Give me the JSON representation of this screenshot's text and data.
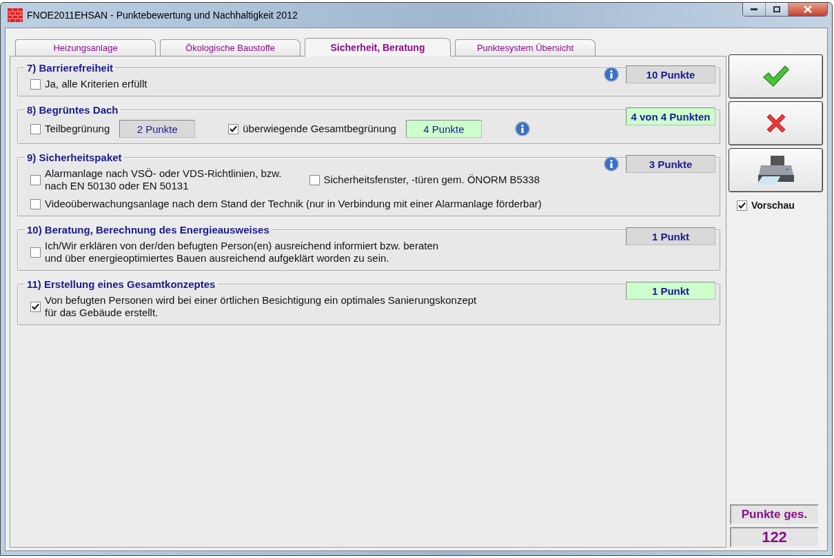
{
  "window": {
    "title": "FNOE2011EHSAN - Punktebewertung und Nachhaltigkeit 2012"
  },
  "tabs": [
    {
      "label": "Heizungsanlage",
      "selected": false
    },
    {
      "label": "Ökologische Baustoffe",
      "selected": false
    },
    {
      "label": "Sicherheit, Beratung",
      "selected": true
    },
    {
      "label": "Punktesystem Übersicht",
      "selected": false
    }
  ],
  "sections": [
    {
      "title": "7) Barrierefreiheit",
      "score": {
        "text": "10 Punkte",
        "achieved": false,
        "info": true
      },
      "rows": [
        [
          {
            "kind": "checkbox",
            "label": "Ja, alle Kriterien erfüllt",
            "checked": false
          }
        ]
      ]
    },
    {
      "title": "8) Begrüntes Dach",
      "score": {
        "text": "4 von 4 Punkten",
        "achieved": true,
        "info": false
      },
      "rows": [
        [
          {
            "kind": "checkbox",
            "label": "Teilbegrünung",
            "checked": false
          },
          {
            "kind": "points",
            "text": "2 Punkte",
            "achieved": false
          },
          {
            "kind": "checkbox",
            "label": "überwiegende Gesamtbegrünung",
            "checked": true
          },
          {
            "kind": "points",
            "text": "4 Punkte",
            "achieved": true
          },
          {
            "kind": "info"
          }
        ]
      ]
    },
    {
      "title": "9) Sicherheitspaket",
      "score": {
        "text": "3 Punkte",
        "achieved": false,
        "info": true
      },
      "rows": [
        [
          {
            "kind": "checkbox",
            "label": "Alarmanlage nach VSÖ- oder VDS-Richtlinien, bzw.\nnach EN 50130 oder EN 50131",
            "checked": false
          },
          {
            "kind": "checkbox",
            "label": "Sicherheitsfenster, -türen gem. ÖNORM B5338",
            "checked": false
          }
        ],
        [
          {
            "kind": "checkbox",
            "label": "Videoüberwachungsanlage nach dem Stand der Technik (nur in Verbindung mit einer Alarmanlage förderbar)",
            "checked": false
          }
        ]
      ]
    },
    {
      "title": "10) Beratung, Berechnung des Energieausweises",
      "score": {
        "text": "1 Punkt",
        "achieved": false,
        "info": false
      },
      "rows": [
        [
          {
            "kind": "checkbox",
            "label": "Ich/Wir erklären von der/den befugten Person(en) ausreichend informiert bzw. beraten\nund über energieoptimiertes Bauen ausreichend aufgeklärt worden zu sein.",
            "checked": false
          }
        ]
      ]
    },
    {
      "title": "11) Erstellung eines Gesamtkonzeptes",
      "score": {
        "text": "1 Punkt",
        "achieved": true,
        "info": false
      },
      "rows": [
        [
          {
            "kind": "checkbox",
            "label": "Von befugten Personen wird bei einer örtlichen Besichtigung ein optimales Sanierungskonzept\nfür das Gebäude erstellt.",
            "checked": true
          }
        ]
      ]
    }
  ],
  "sidebar": {
    "buttons": [
      {
        "kind": "ok"
      },
      {
        "kind": "cancel"
      },
      {
        "kind": "print"
      }
    ],
    "preview": {
      "label": "Vorschau",
      "checked": true
    },
    "total": {
      "label": "Punkte ges.",
      "value": "122"
    }
  }
}
